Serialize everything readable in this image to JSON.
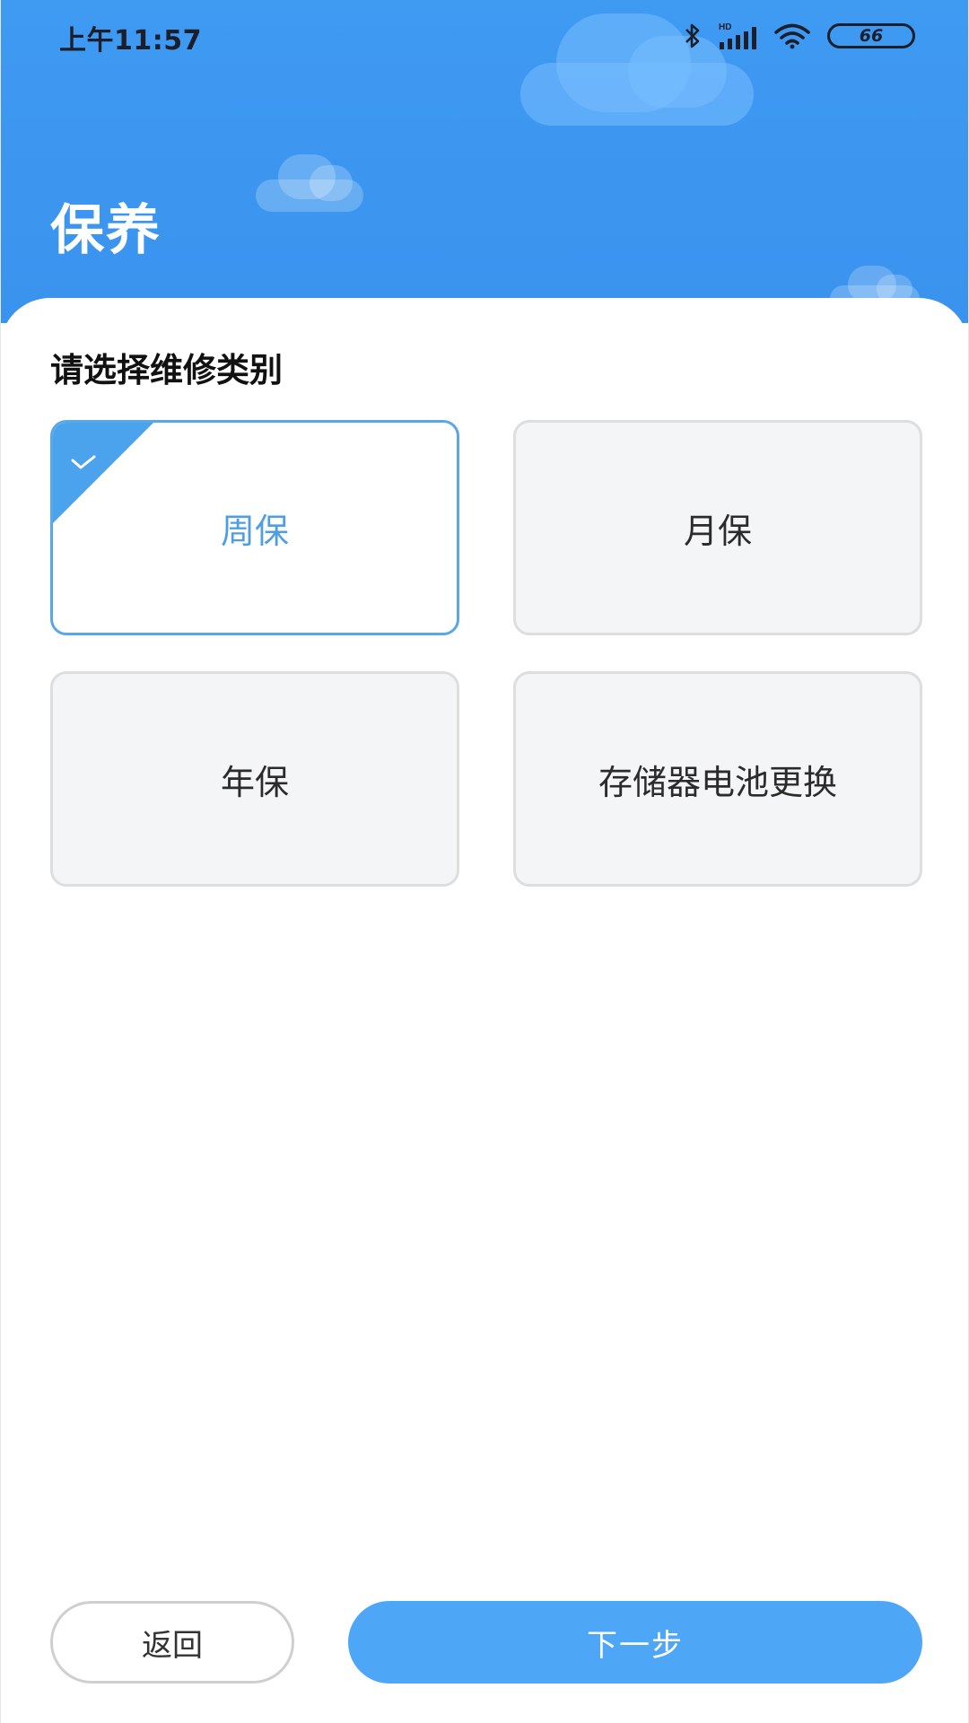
{
  "status_bar": {
    "time": "上午11:57",
    "network_label": "HD",
    "battery_level": "66",
    "icons": [
      "bluetooth-icon",
      "signal-icon",
      "wifi-icon",
      "battery-icon"
    ]
  },
  "header": {
    "title": "保养"
  },
  "main": {
    "section_label": "请选择维修类别",
    "options": [
      {
        "label": "周保",
        "selected": true
      },
      {
        "label": "月保",
        "selected": false
      },
      {
        "label": "年保",
        "selected": false
      },
      {
        "label": "存储器电池更换",
        "selected": false
      }
    ]
  },
  "footer": {
    "back_label": "返回",
    "next_label": "下一步"
  },
  "colors": {
    "header_blue": "#3f9af2",
    "selected_border": "#5aa7e6",
    "selected_text": "#4f9fe0",
    "primary_button": "#4ea6f7",
    "option_bg": "#f4f5f7"
  }
}
